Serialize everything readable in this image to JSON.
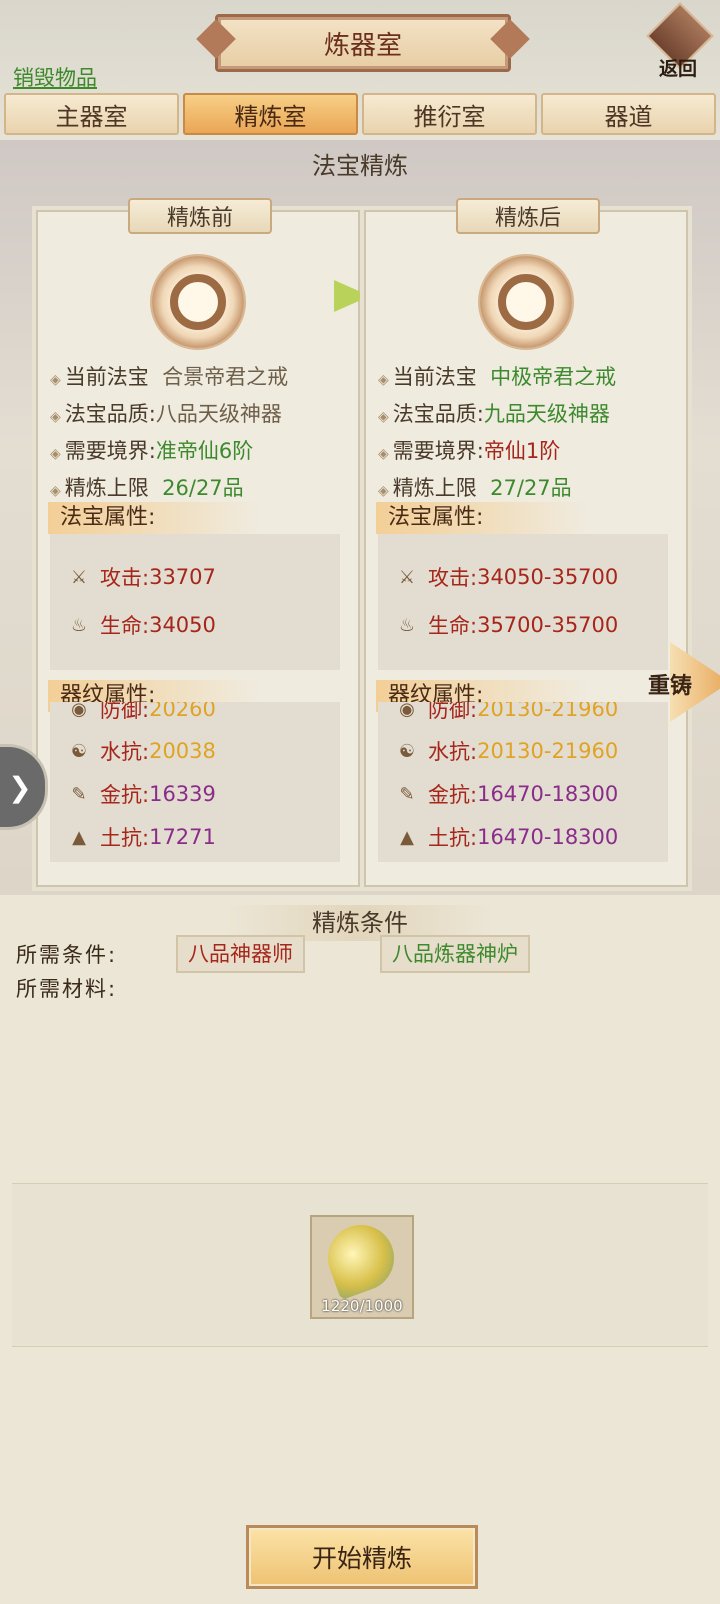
{
  "header": {
    "title": "炼器室",
    "back_label": "返回",
    "destroy_link": "销毁物品"
  },
  "tabs": [
    {
      "label": "主器室",
      "active": false
    },
    {
      "label": "精炼室",
      "active": true
    },
    {
      "label": "推衍室",
      "active": false
    },
    {
      "label": "器道",
      "active": false
    }
  ],
  "section_title": "法宝精炼",
  "before": {
    "tag": "精炼前",
    "fields": [
      {
        "key": "当前法宝",
        "value": "合景帝君之戒"
      },
      {
        "key": "法宝品质:",
        "value": "八品天级神器"
      },
      {
        "key": "需要境界:",
        "value": "准帝仙6阶"
      },
      {
        "key": "精炼上限",
        "value": "26/27品"
      }
    ],
    "attr_title": "法宝属性:",
    "attrs": [
      {
        "label": "攻击:",
        "value": "33707"
      },
      {
        "label": "生命:",
        "value": "34050"
      }
    ],
    "pattern_title": "器纹属性:",
    "patterns": [
      {
        "label": "防御:",
        "value": "20260"
      },
      {
        "label": "水抗:",
        "value": "20038"
      },
      {
        "label": "金抗:",
        "value": "16339"
      },
      {
        "label": "土抗:",
        "value": "17271"
      }
    ]
  },
  "after": {
    "tag": "精炼后",
    "fields": [
      {
        "key": "当前法宝",
        "value": "中极帝君之戒"
      },
      {
        "key": "法宝品质:",
        "value": "九品天级神器"
      },
      {
        "key": "需要境界:",
        "value": "帝仙1阶"
      },
      {
        "key": "精炼上限",
        "value": "27/27品"
      }
    ],
    "attr_title": "法宝属性:",
    "attrs": [
      {
        "label": "攻击:",
        "value": "34050-35700"
      },
      {
        "label": "生命:",
        "value": "35700-35700"
      }
    ],
    "pattern_title": "器纹属性:",
    "patterns": [
      {
        "label": "防御:",
        "value": "20130-21960"
      },
      {
        "label": "水抗:",
        "value": "20130-21960"
      },
      {
        "label": "金抗:",
        "value": "16470-18300"
      },
      {
        "label": "土抗:",
        "value": "16470-18300"
      }
    ]
  },
  "recast_label": "重铸",
  "conditions": {
    "title": "精炼条件",
    "required_label": "所需条件:",
    "materials_label": "所需材料:",
    "required_items": [
      "八品神器师",
      "八品炼器神炉"
    ],
    "material_count": "1220/1000"
  },
  "start_button": "开始精炼",
  "colors": {
    "green": "#3d8a2e",
    "red": "#a6261b",
    "gold": "#e0a323",
    "purple": "#8a2c8a",
    "active_tab": "#eaa656"
  }
}
